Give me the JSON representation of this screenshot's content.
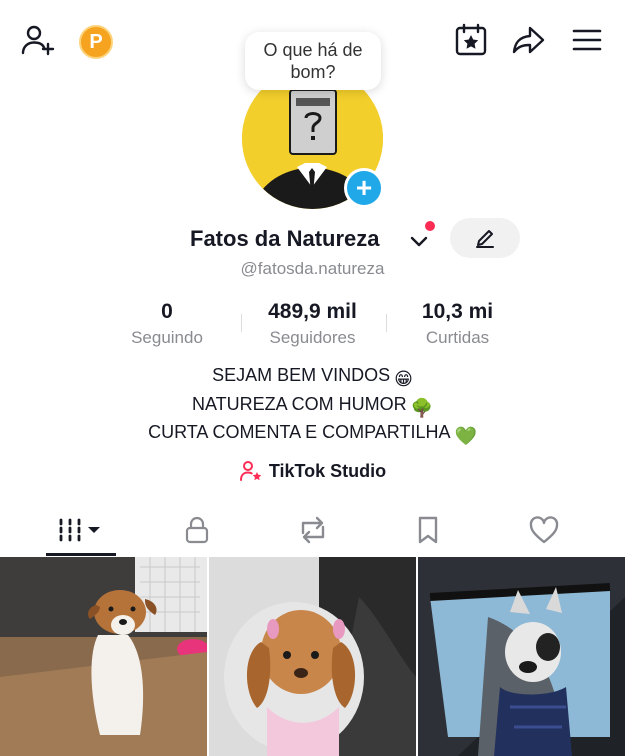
{
  "header": {
    "add_friend_icon": "person-plus-icon",
    "coin_letter": "P",
    "calendar_icon": "calendar-star-icon",
    "share_icon": "share-arrow-icon",
    "menu_icon": "hamburger-menu-icon"
  },
  "profile": {
    "bubble_text": "O que há de bom?",
    "display_name": "Fatos da Natureza",
    "username": "@fatosda.natureza",
    "add_button_symbol": "+"
  },
  "stats": [
    {
      "value": "0",
      "label": "Seguindo"
    },
    {
      "value": "489,9 mil",
      "label": "Seguidores"
    },
    {
      "value": "10,3 mi",
      "label": "Curtidas"
    }
  ],
  "bio": {
    "line1": "SEJAM BEM VINDOS",
    "line1_emoji": "😁",
    "line2": "NATUREZA COM HUMOR",
    "line2_emoji": "🌳",
    "line3": "CURTA COMENTA E COMPARTILHA",
    "line3_emoji": "💚"
  },
  "studio": {
    "label": "TikTok Studio"
  },
  "tabs": [
    {
      "icon": "videos-grid-icon",
      "active": true
    },
    {
      "icon": "lock-icon",
      "active": false
    },
    {
      "icon": "repost-icon",
      "active": false
    },
    {
      "icon": "bookmark-icon",
      "active": false
    },
    {
      "icon": "heart-icon",
      "active": false
    }
  ],
  "videos": [
    {
      "subject": "puppy-jack-russell"
    },
    {
      "subject": "puppy-cocker-spaniel"
    },
    {
      "subject": "puppy-in-car"
    }
  ],
  "colors": {
    "accent": "#fe2c55",
    "badge": "#20a8e8",
    "coin": "#f6a31f",
    "avatar_bg": "#f3cf2c"
  }
}
